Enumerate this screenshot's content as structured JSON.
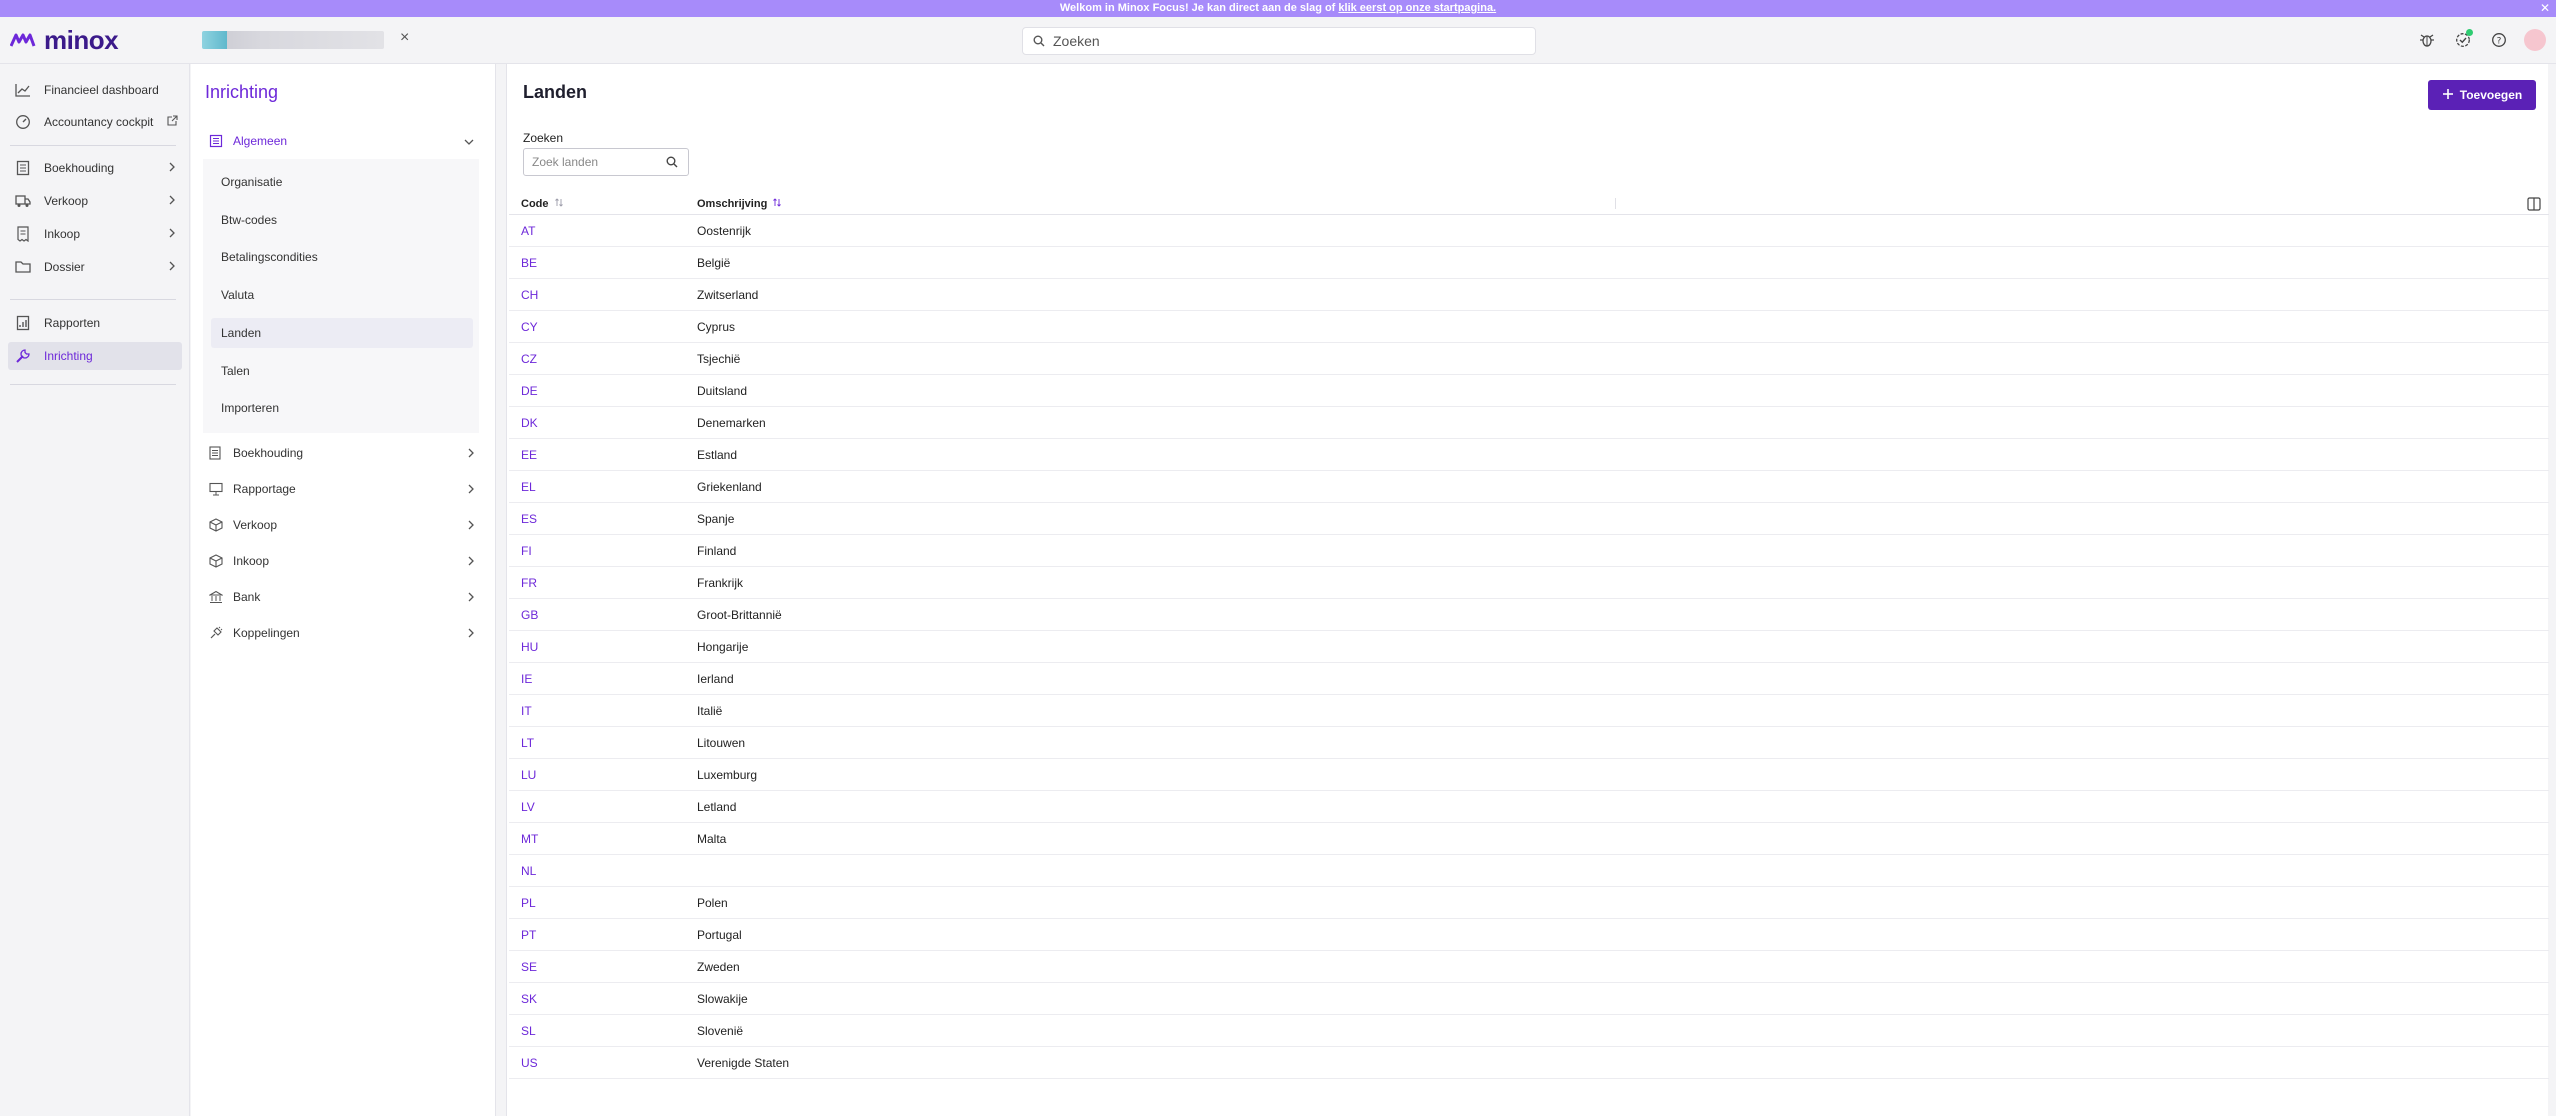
{
  "banner": {
    "text": "Welkom in Minox Focus! Je kan direct aan de slag of ",
    "link": "klik eerst op onze startpagina."
  },
  "app": {
    "logo_text": "minox",
    "brand_color": "#6d28d9",
    "banner_color": "#a78bfa",
    "button_color": "#5b21b6"
  },
  "topbar": {
    "search_placeholder": "Zoeken"
  },
  "leftnav": {
    "items": [
      {
        "label": "Financieel dashboard",
        "icon": "chart-icon"
      },
      {
        "label": "Accountancy cockpit",
        "icon": "gauge-icon"
      },
      {
        "label": "Boekhouding",
        "icon": "ledger-icon"
      },
      {
        "label": "Verkoop",
        "icon": "truck-icon"
      },
      {
        "label": "Inkoop",
        "icon": "receipt-icon"
      },
      {
        "label": "Dossier",
        "icon": "folder-icon"
      },
      {
        "label": "Rapporten",
        "icon": "report-icon"
      },
      {
        "label": "Inrichting",
        "icon": "wrench-icon"
      }
    ]
  },
  "settings": {
    "title": "Inrichting",
    "open_group": "Algemeen",
    "sub_items": [
      "Organisatie",
      "Btw-codes",
      "Betalingscondities",
      "Valuta",
      "Landen",
      "Talen",
      "Importeren"
    ],
    "groups": [
      "Boekhouding",
      "Rapportage",
      "Verkoop",
      "Inkoop",
      "Bank",
      "Koppelingen"
    ]
  },
  "main": {
    "title": "Landen",
    "add_label": "Toevoegen",
    "search_label": "Zoeken",
    "search_placeholder": "Zoek landen",
    "columns": {
      "code": "Code",
      "description": "Omschrijving"
    },
    "rows": [
      {
        "code": "AT",
        "description": "Oostenrijk"
      },
      {
        "code": "BE",
        "description": "België"
      },
      {
        "code": "CH",
        "description": "Zwitserland"
      },
      {
        "code": "CY",
        "description": "Cyprus"
      },
      {
        "code": "CZ",
        "description": "Tsjechië"
      },
      {
        "code": "DE",
        "description": "Duitsland"
      },
      {
        "code": "DK",
        "description": "Denemarken"
      },
      {
        "code": "EE",
        "description": "Estland"
      },
      {
        "code": "EL",
        "description": "Griekenland"
      },
      {
        "code": "ES",
        "description": "Spanje"
      },
      {
        "code": "FI",
        "description": "Finland"
      },
      {
        "code": "FR",
        "description": "Frankrijk"
      },
      {
        "code": "GB",
        "description": "Groot-Brittannië"
      },
      {
        "code": "HU",
        "description": "Hongarije"
      },
      {
        "code": "IE",
        "description": "Ierland"
      },
      {
        "code": "IT",
        "description": "Italië"
      },
      {
        "code": "LT",
        "description": "Litouwen"
      },
      {
        "code": "LU",
        "description": "Luxemburg"
      },
      {
        "code": "LV",
        "description": "Letland"
      },
      {
        "code": "MT",
        "description": "Malta"
      },
      {
        "code": "NL",
        "description": ""
      },
      {
        "code": "PL",
        "description": "Polen"
      },
      {
        "code": "PT",
        "description": "Portugal"
      },
      {
        "code": "SE",
        "description": "Zweden"
      },
      {
        "code": "SK",
        "description": "Slowakije"
      },
      {
        "code": "SL",
        "description": "Slovenië"
      },
      {
        "code": "US",
        "description": "Verenigde Staten"
      }
    ]
  }
}
